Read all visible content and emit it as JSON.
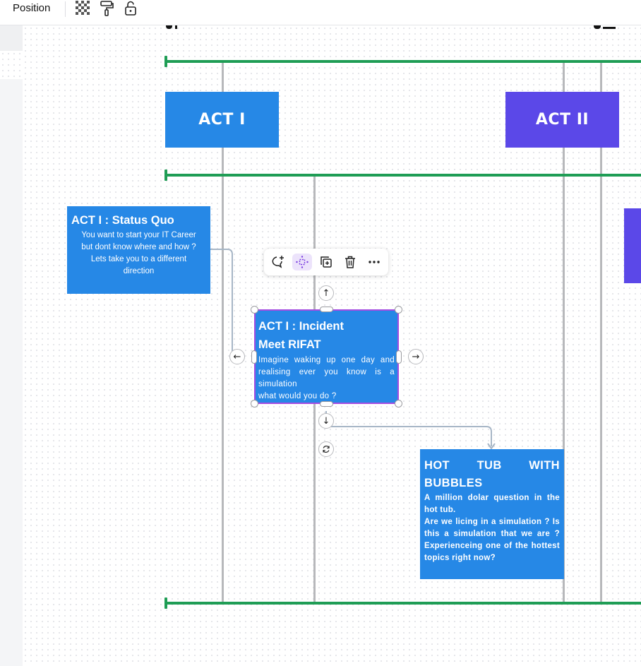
{
  "toolbar": {
    "position_label": "Position",
    "icons": [
      "transparency-icon",
      "paint-roller-icon",
      "unlock-icon"
    ]
  },
  "acts": {
    "act1_label": "ACT I",
    "act2_label": "ACT II"
  },
  "status_quo": {
    "title": "ACT I : Status Quo",
    "lines": [
      "You want to start your IT Career",
      "but dont know where and how ?",
      "Lets take you to a different",
      "direction"
    ]
  },
  "incident": {
    "title_line1": "ACT I : Incident",
    "title_line2": "Meet RIFAT",
    "body": "Imagine waking up one day and realising ever you know is a simulation",
    "body2": "what would you do ?"
  },
  "hot_tub": {
    "title": "HOT TUB WITH BUBBLES",
    "body1": "A million dolar question in the hot tub.",
    "body2": "Are we licing in a simulation ? Is this a simulation that we are ? Experienceing one of the hottest topics right now?"
  },
  "context_menu": {
    "items": [
      "comment-add-icon",
      "move-icon",
      "duplicate-icon",
      "delete-icon",
      "more-icon"
    ],
    "active_item": "move-icon"
  },
  "colors": {
    "green_line": "#1f9d55",
    "card_blue": "#2688e6",
    "act1_blue": "#2688e6",
    "act2_purple": "#5b48e8",
    "selection": "#a54ce0"
  }
}
